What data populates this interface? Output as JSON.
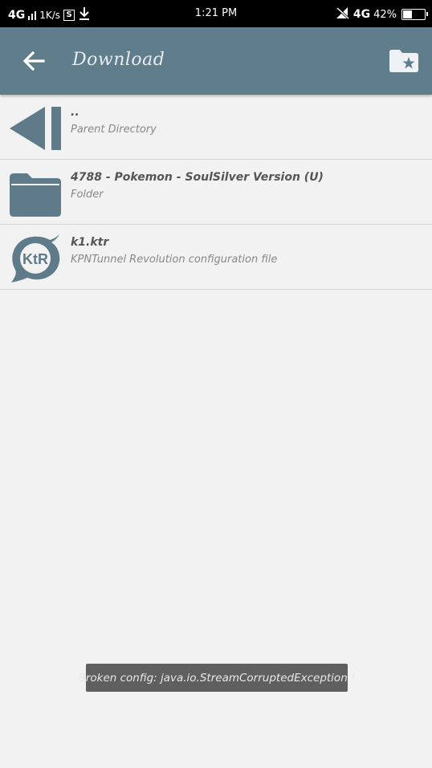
{
  "status_bar": {
    "network_left": "4G",
    "speed": "1K/s",
    "s_badge": "S",
    "time": "1:21 PM",
    "network_right": "4G",
    "battery_percent": "42%",
    "battery_level": 0.42
  },
  "app_bar": {
    "title": "Download"
  },
  "files": [
    {
      "title": "..",
      "subtitle": "Parent Directory",
      "icon": "parent-directory-icon"
    },
    {
      "title": "4788 - Pokemon - SoulSilver Version (U)",
      "subtitle": "Folder",
      "icon": "folder-icon"
    },
    {
      "title": "k1.ktr",
      "subtitle": "KPNTunnel Revolution configuration file",
      "icon": "ktr-file-icon",
      "icon_text": "KtR"
    }
  ],
  "toast": {
    "message": "Broken config: java.io.StreamCorruptedException !"
  },
  "colors": {
    "app_bar": "#607d8b",
    "icon": "#5f7b8a",
    "background": "#f2f2f2",
    "toast": "#5f5f5f"
  }
}
